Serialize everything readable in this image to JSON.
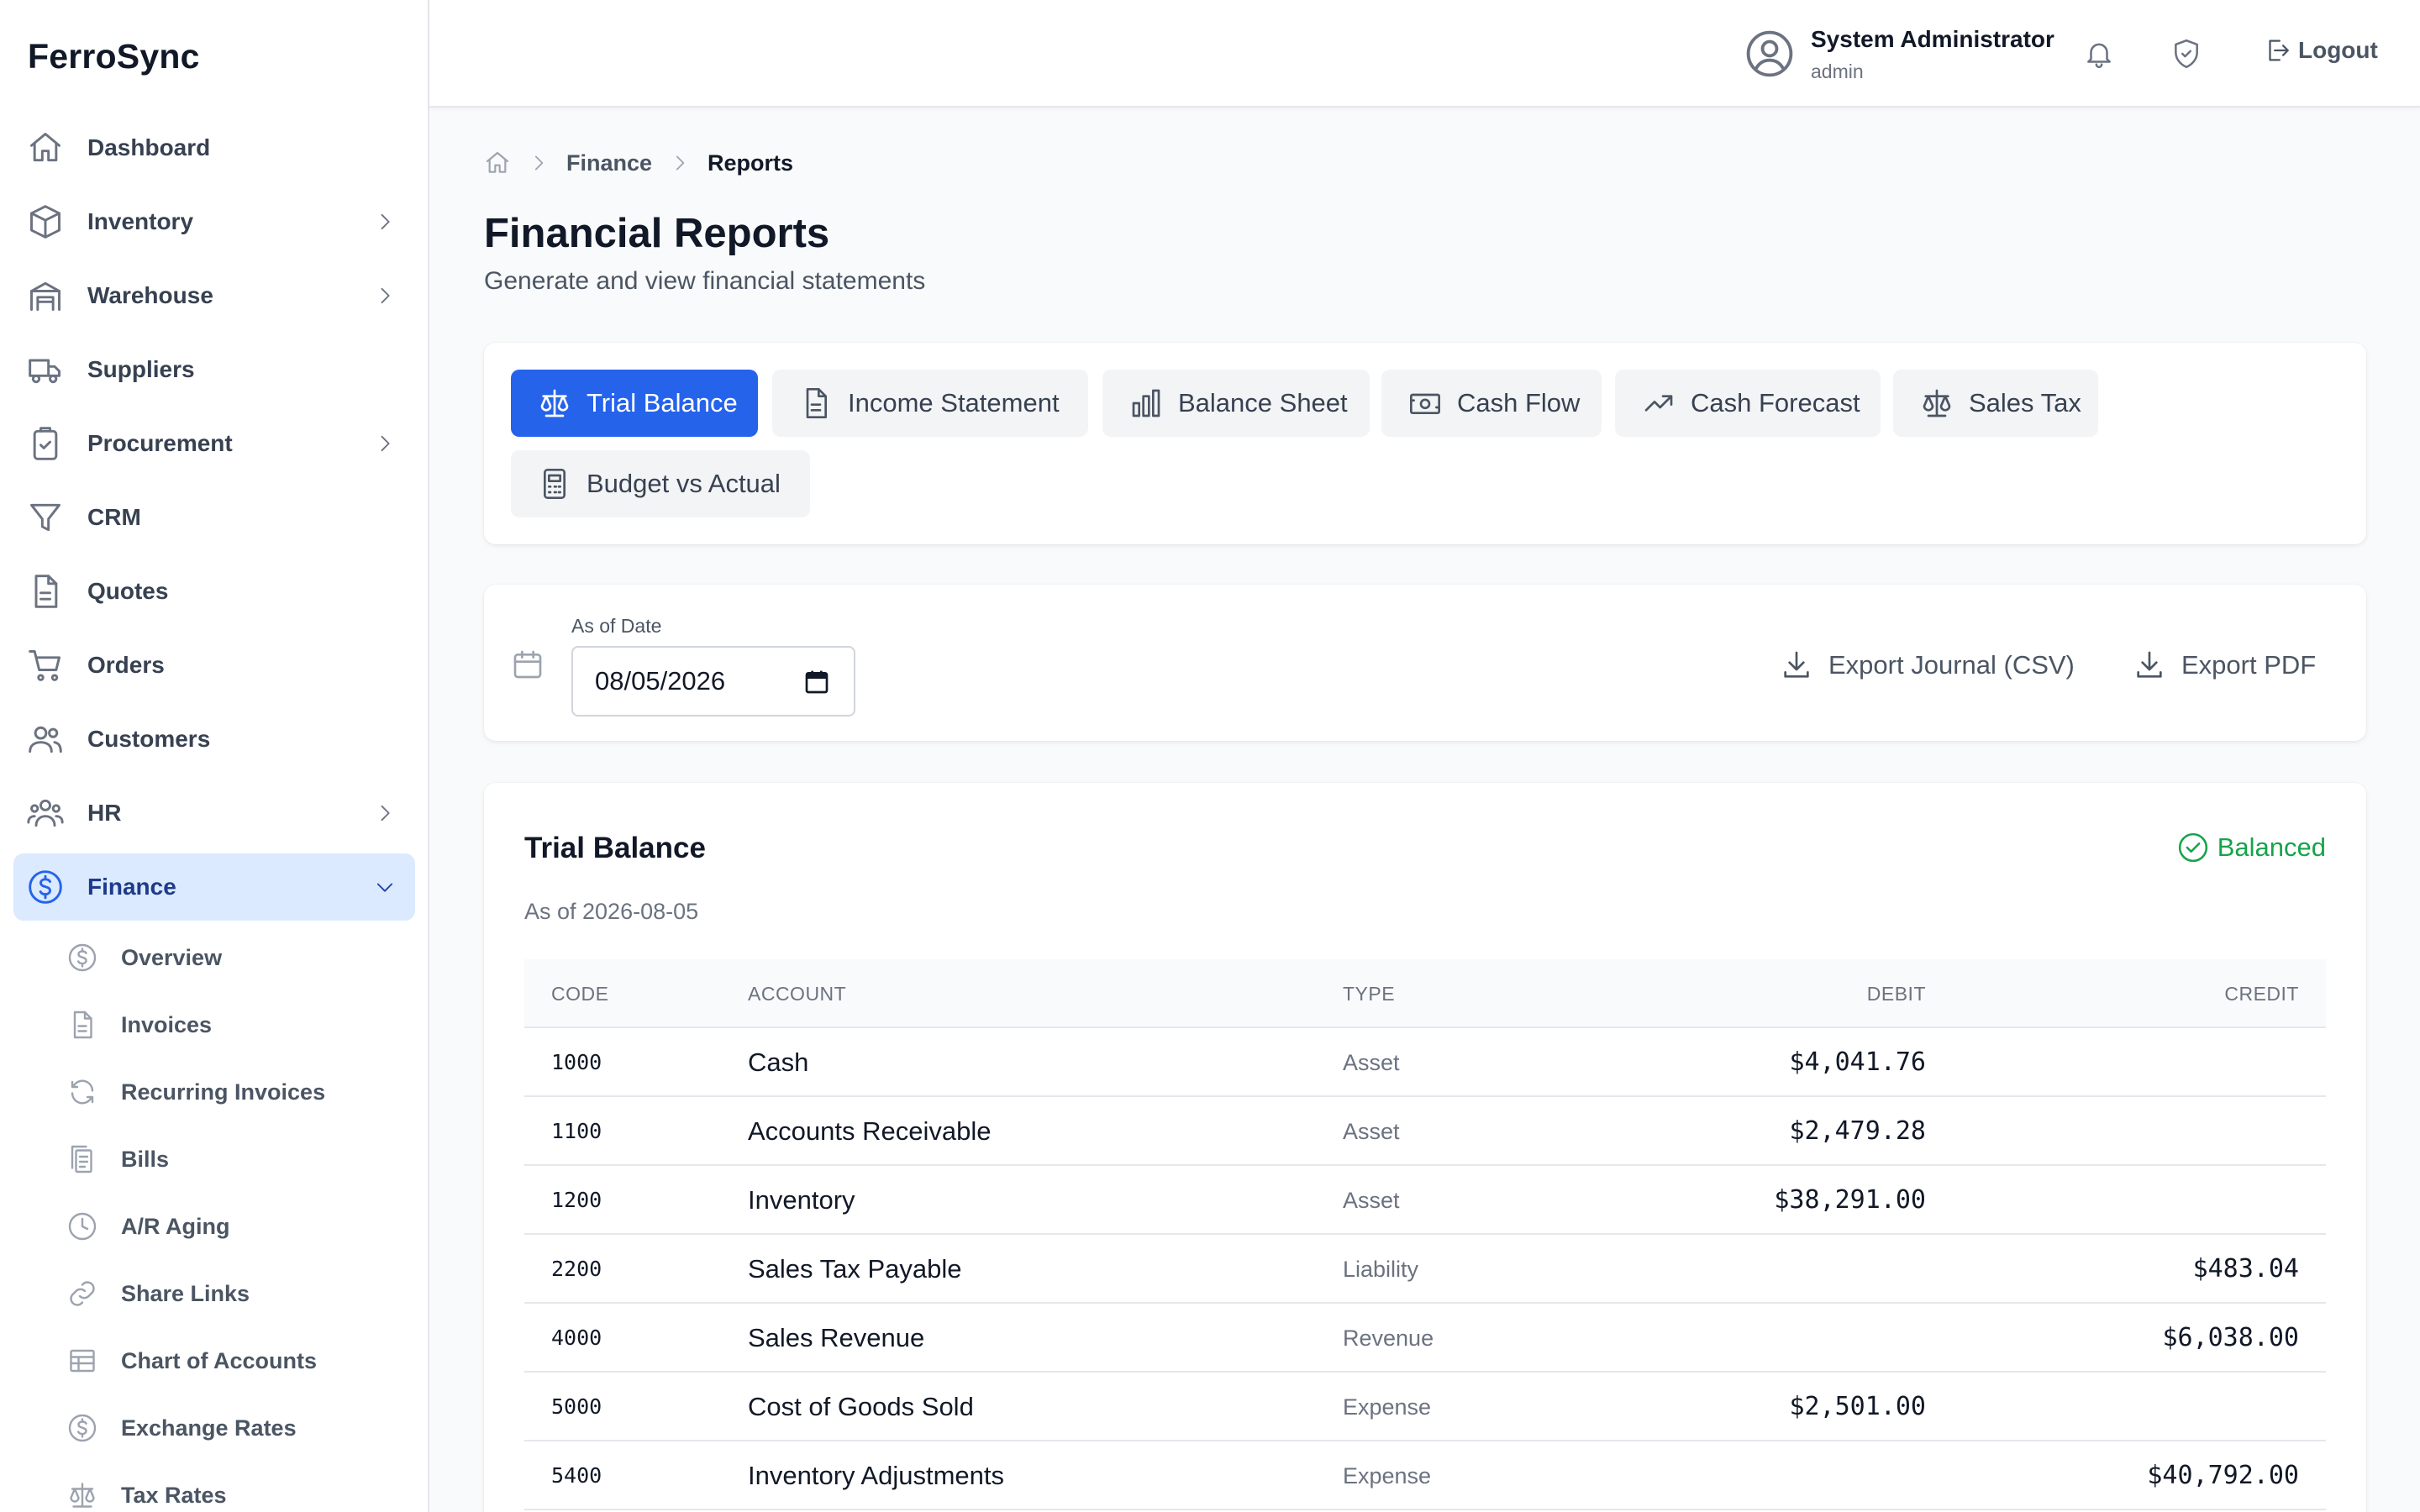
{
  "app": {
    "brand": "FerroSync"
  },
  "sidebar": {
    "items": [
      {
        "label": "Dashboard",
        "icon": "home-icon"
      },
      {
        "label": "Inventory",
        "icon": "box-icon",
        "expandable": true
      },
      {
        "label": "Warehouse",
        "icon": "warehouse-icon",
        "expandable": true
      },
      {
        "label": "Suppliers",
        "icon": "truck-icon"
      },
      {
        "label": "Procurement",
        "icon": "clipboard-icon",
        "expandable": true
      },
      {
        "label": "CRM",
        "icon": "funnel-icon"
      },
      {
        "label": "Quotes",
        "icon": "document-icon"
      },
      {
        "label": "Orders",
        "icon": "cart-icon"
      },
      {
        "label": "Customers",
        "icon": "users-icon"
      },
      {
        "label": "HR",
        "icon": "team-icon",
        "expandable": true
      },
      {
        "label": "Finance",
        "icon": "dollar-circle-icon",
        "expandable": true,
        "active": true
      }
    ],
    "finance_sub": [
      {
        "label": "Overview",
        "icon": "dollar-circle-icon"
      },
      {
        "label": "Invoices",
        "icon": "document-icon"
      },
      {
        "label": "Recurring Invoices",
        "icon": "refresh-icon"
      },
      {
        "label": "Bills",
        "icon": "receipt-icon"
      },
      {
        "label": "A/R Aging",
        "icon": "clock-icon"
      },
      {
        "label": "Share Links",
        "icon": "link-icon"
      },
      {
        "label": "Chart of Accounts",
        "icon": "table-icon"
      },
      {
        "label": "Exchange Rates",
        "icon": "dollar-circle-icon"
      },
      {
        "label": "Tax Rates",
        "icon": "scale-icon"
      }
    ]
  },
  "header": {
    "user_name": "System Administrator",
    "user_role": "admin",
    "logout_label": "Logout"
  },
  "breadcrumb": {
    "items": [
      "Finance",
      "Reports"
    ]
  },
  "page": {
    "title": "Financial Reports",
    "subtitle": "Generate and view financial statements"
  },
  "report_tabs": [
    {
      "label": "Trial Balance",
      "icon": "scale-icon",
      "active": true
    },
    {
      "label": "Income Statement",
      "icon": "document-icon"
    },
    {
      "label": "Balance Sheet",
      "icon": "bar-chart-icon"
    },
    {
      "label": "Cash Flow",
      "icon": "banknote-icon"
    },
    {
      "label": "Cash Forecast",
      "icon": "trending-up-icon"
    },
    {
      "label": "Sales Tax",
      "icon": "scale-icon"
    },
    {
      "label": "Budget vs Actual",
      "icon": "calculator-icon"
    }
  ],
  "filters": {
    "date_label": "As of Date",
    "date_value": "08/05/2026",
    "export_csv_label": "Export Journal (CSV)",
    "export_pdf_label": "Export PDF"
  },
  "trial_balance": {
    "title": "Trial Balance",
    "status": "Balanced",
    "status_color": "#16a34a",
    "as_of": "As of 2026-08-05",
    "columns": [
      "CODE",
      "ACCOUNT",
      "TYPE",
      "DEBIT",
      "CREDIT"
    ],
    "rows": [
      {
        "code": "1000",
        "account": "Cash",
        "type": "Asset",
        "debit": "$4,041.76",
        "credit": ""
      },
      {
        "code": "1100",
        "account": "Accounts Receivable",
        "type": "Asset",
        "debit": "$2,479.28",
        "credit": ""
      },
      {
        "code": "1200",
        "account": "Inventory",
        "type": "Asset",
        "debit": "$38,291.00",
        "credit": ""
      },
      {
        "code": "2200",
        "account": "Sales Tax Payable",
        "type": "Liability",
        "debit": "",
        "credit": "$483.04"
      },
      {
        "code": "4000",
        "account": "Sales Revenue",
        "type": "Revenue",
        "debit": "",
        "credit": "$6,038.00"
      },
      {
        "code": "5000",
        "account": "Cost of Goods Sold",
        "type": "Expense",
        "debit": "$2,501.00",
        "credit": ""
      },
      {
        "code": "5400",
        "account": "Inventory Adjustments",
        "type": "Expense",
        "debit": "",
        "credit": "$40,792.00"
      }
    ]
  },
  "colors": {
    "accent": "#2563eb",
    "active_nav_bg": "#dbeafe"
  }
}
